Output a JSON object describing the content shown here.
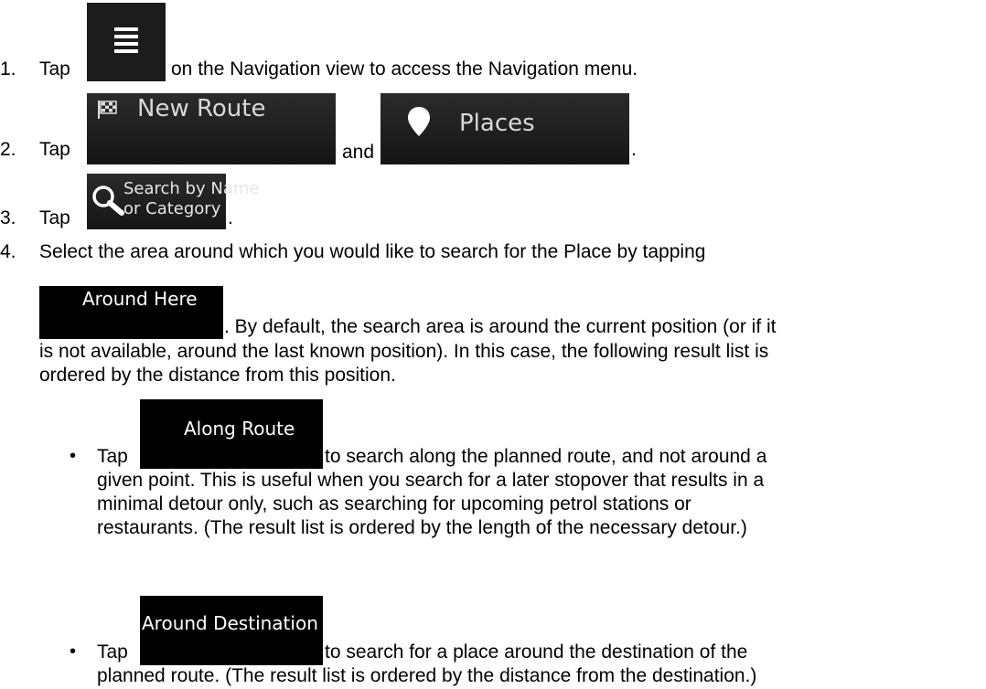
{
  "steps": [
    {
      "num": "1.",
      "pre": "Tap",
      "post": "on the Navigation view to access the Navigation menu."
    },
    {
      "num": "2.",
      "pre": "Tap",
      "mid": "and",
      "post": "."
    },
    {
      "num": "3.",
      "pre": "Tap",
      "post": "."
    },
    {
      "num": "4.",
      "line1": "Select the area around which you would like to search for the Place by tapping",
      "after_btn": ". By default, the search area is around the current position (or if it",
      "line3": "is not available, around the last known position). In this case, the following result list is",
      "line4": "ordered by the distance from this position."
    }
  ],
  "buttons": {
    "menu_icon": "menu-icon",
    "new_route": "New Route",
    "places": "Places",
    "search_line1": "Search by Name",
    "search_line2": "or Category",
    "around_here": "Around Here",
    "along_route": "Along Route",
    "around_destination": "Around Destination"
  },
  "bullets": [
    {
      "symbol": "•",
      "pre": "Tap",
      "post": "to search along the planned route, and not around a",
      "l2": "given point. This is useful when you search for a later stopover that results in a",
      "l3": "minimal detour only, such as searching for upcoming petrol stations or",
      "l4": "restaurants. (The result list is ordered by the length of the necessary detour.)"
    },
    {
      "symbol": "•",
      "pre": "Tap",
      "post": "to search for a place around the destination of the",
      "l2": "planned route. (The result list is ordered by the distance from the destination.)"
    }
  ]
}
